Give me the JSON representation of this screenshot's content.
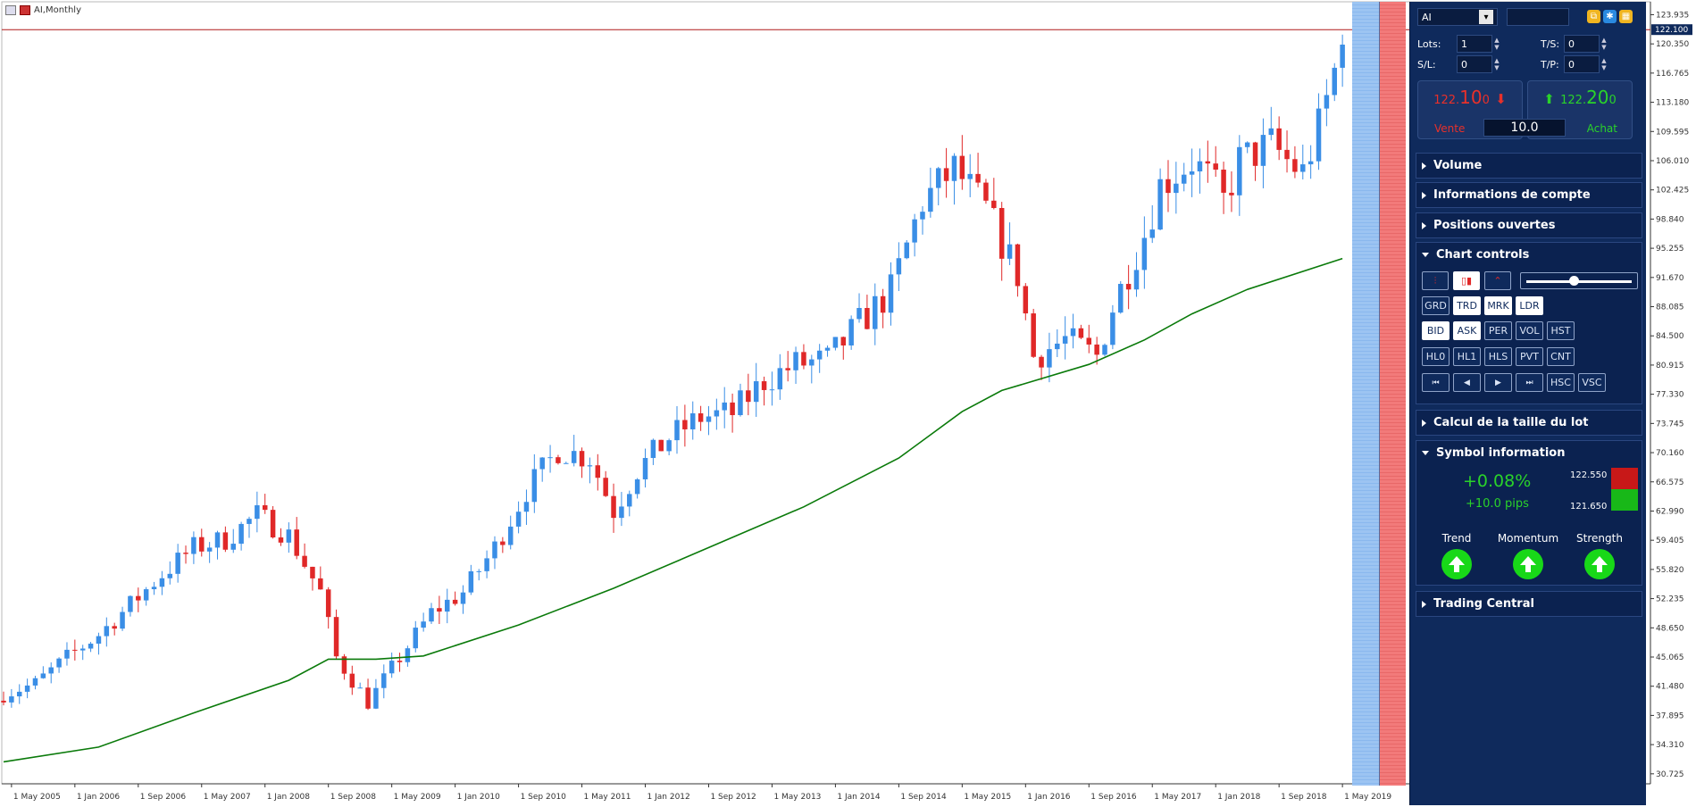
{
  "chart": {
    "title": "AI,Monthly",
    "symbol": "AI",
    "current_price_label": "122.100",
    "colors": {
      "up": "#3a8ee6",
      "down": "#e02828",
      "ma": "#0a7a0a",
      "price_line": "#b01818"
    }
  },
  "chart_data": {
    "type": "candlestick",
    "title": "AI,Monthly",
    "ylim": [
      29.5,
      125.3
    ],
    "y_ticks": [
      "123.935",
      "120.350",
      "116.765",
      "113.180",
      "109.595",
      "106.010",
      "102.425",
      "98.840",
      "95.255",
      "91.670",
      "88.085",
      "84.500",
      "80.915",
      "77.330",
      "73.745",
      "70.160",
      "66.575",
      "62.990",
      "59.405",
      "55.820",
      "52.235",
      "48.650",
      "45.065",
      "41.480",
      "37.895",
      "34.310",
      "30.725"
    ],
    "x_ticks": [
      "1 May 2005",
      "1 Jan 2006",
      "1 Sep 2006",
      "1 May 2007",
      "1 Jan 2008",
      "1 Sep 2008",
      "1 May 2009",
      "1 Jan 2010",
      "1 Sep 2010",
      "1 May 2011",
      "1 Jan 2012",
      "1 Sep 2012",
      "1 May 2013",
      "1 Jan 2014",
      "1 Sep 2014",
      "1 May 2015",
      "1 Jan 2016",
      "1 Sep 2016",
      "1 May 2017",
      "1 Jan 2018",
      "1 Sep 2018",
      "1 May 2019"
    ],
    "x_range": [
      "2005-04",
      "2019-06"
    ],
    "close_path": [
      [
        "2005-04",
        40.5
      ],
      [
        "2005-08",
        41.8
      ],
      [
        "2005-12",
        45.0
      ],
      [
        "2006-04",
        47.8
      ],
      [
        "2006-08",
        51.5
      ],
      [
        "2006-12",
        55.2
      ],
      [
        "2007-04",
        58.5
      ],
      [
        "2007-08",
        59.5
      ],
      [
        "2007-12",
        62.5
      ],
      [
        "2008-04",
        60.0
      ],
      [
        "2008-08",
        53.0
      ],
      [
        "2008-10",
        45.0
      ],
      [
        "2009-02",
        39.5
      ],
      [
        "2009-06",
        45.0
      ],
      [
        "2009-10",
        50.5
      ],
      [
        "2010-02",
        53.0
      ],
      [
        "2010-06",
        58.5
      ],
      [
        "2010-10",
        65.5
      ],
      [
        "2011-02",
        70.5
      ],
      [
        "2011-06",
        69.5
      ],
      [
        "2011-09",
        63.0
      ],
      [
        "2011-12",
        68.0
      ],
      [
        "2012-04",
        72.0
      ],
      [
        "2012-08",
        74.5
      ],
      [
        "2012-12",
        75.0
      ],
      [
        "2013-04",
        79.0
      ],
      [
        "2013-08",
        81.0
      ],
      [
        "2013-12",
        81.5
      ],
      [
        "2014-04",
        86.0
      ],
      [
        "2014-08",
        90.0
      ],
      [
        "2014-12",
        101.0
      ],
      [
        "2015-04",
        105.0
      ],
      [
        "2015-08",
        100.0
      ],
      [
        "2015-12",
        92.0
      ],
      [
        "2016-02",
        82.0
      ],
      [
        "2016-06",
        84.0
      ],
      [
        "2016-10",
        82.0
      ],
      [
        "2016-12",
        88.0
      ],
      [
        "2017-04",
        97.0
      ],
      [
        "2017-06",
        103.0
      ],
      [
        "2017-10",
        106.0
      ],
      [
        "2017-12",
        104.0
      ],
      [
        "2018-02",
        101.0
      ],
      [
        "2018-04",
        106.0
      ],
      [
        "2018-08",
        108.0
      ],
      [
        "2018-10",
        106.0
      ],
      [
        "2018-12",
        104.5
      ],
      [
        "2019-02",
        110.0
      ],
      [
        "2019-04",
        117.0
      ],
      [
        "2019-05",
        122.6
      ]
    ],
    "ma_path": [
      [
        "2005-04",
        32.2
      ],
      [
        "2006-04",
        34.0
      ],
      [
        "2007-04",
        38.2
      ],
      [
        "2008-04",
        42.2
      ],
      [
        "2008-09",
        44.8
      ],
      [
        "2009-03",
        44.8
      ],
      [
        "2009-09",
        45.2
      ],
      [
        "2010-09",
        49.0
      ],
      [
        "2011-09",
        53.5
      ],
      [
        "2012-09",
        58.5
      ],
      [
        "2013-09",
        63.5
      ],
      [
        "2014-09",
        69.5
      ],
      [
        "2015-05",
        75.2
      ],
      [
        "2015-10",
        77.8
      ],
      [
        "2016-09",
        81.0
      ],
      [
        "2017-04",
        84.0
      ],
      [
        "2017-10",
        87.2
      ],
      [
        "2018-05",
        90.2
      ],
      [
        "2019-05",
        94.0
      ]
    ]
  },
  "panel": {
    "symbol_select": "AI",
    "fields": {
      "lots_label": "Lots:",
      "lots_value": "1",
      "ts_label": "T/S:",
      "ts_value": "0",
      "sl_label": "S/L:",
      "sl_value": "0",
      "tp_label": "T/P:",
      "tp_value": "0"
    },
    "sell": {
      "price_prefix": "122.",
      "price_big": "10",
      "price_suffix": "0",
      "label": "Vente"
    },
    "buy": {
      "price_prefix": "122.",
      "price_big": "20",
      "price_suffix": "0",
      "label": "Achat"
    },
    "spread": "10.0",
    "sections": {
      "volume": "Volume",
      "account": "Informations de compte",
      "positions": "Positions ouvertes",
      "chart_controls": "Chart controls",
      "lot_calc": "Calcul de la taille du lot",
      "symbol_info": "Symbol information",
      "trading_central": "Trading Central"
    },
    "control_buttons": {
      "row1": [
        "GRD",
        "TRD",
        "MRK",
        "LDR"
      ],
      "row2": [
        "BID",
        "ASK",
        "PER",
        "VOL",
        "HST"
      ],
      "row3": [
        "HL0",
        "HL1",
        "HLS",
        "PVT",
        "CNT"
      ],
      "row4": [
        "HSC",
        "VSC"
      ]
    },
    "symbol_info": {
      "change_pct": "+0.08%",
      "change_pips": "+10.0 pips",
      "ask": "122.550",
      "bid": "121.650",
      "indicators": [
        "Trend",
        "Momentum",
        "Strength"
      ]
    }
  }
}
